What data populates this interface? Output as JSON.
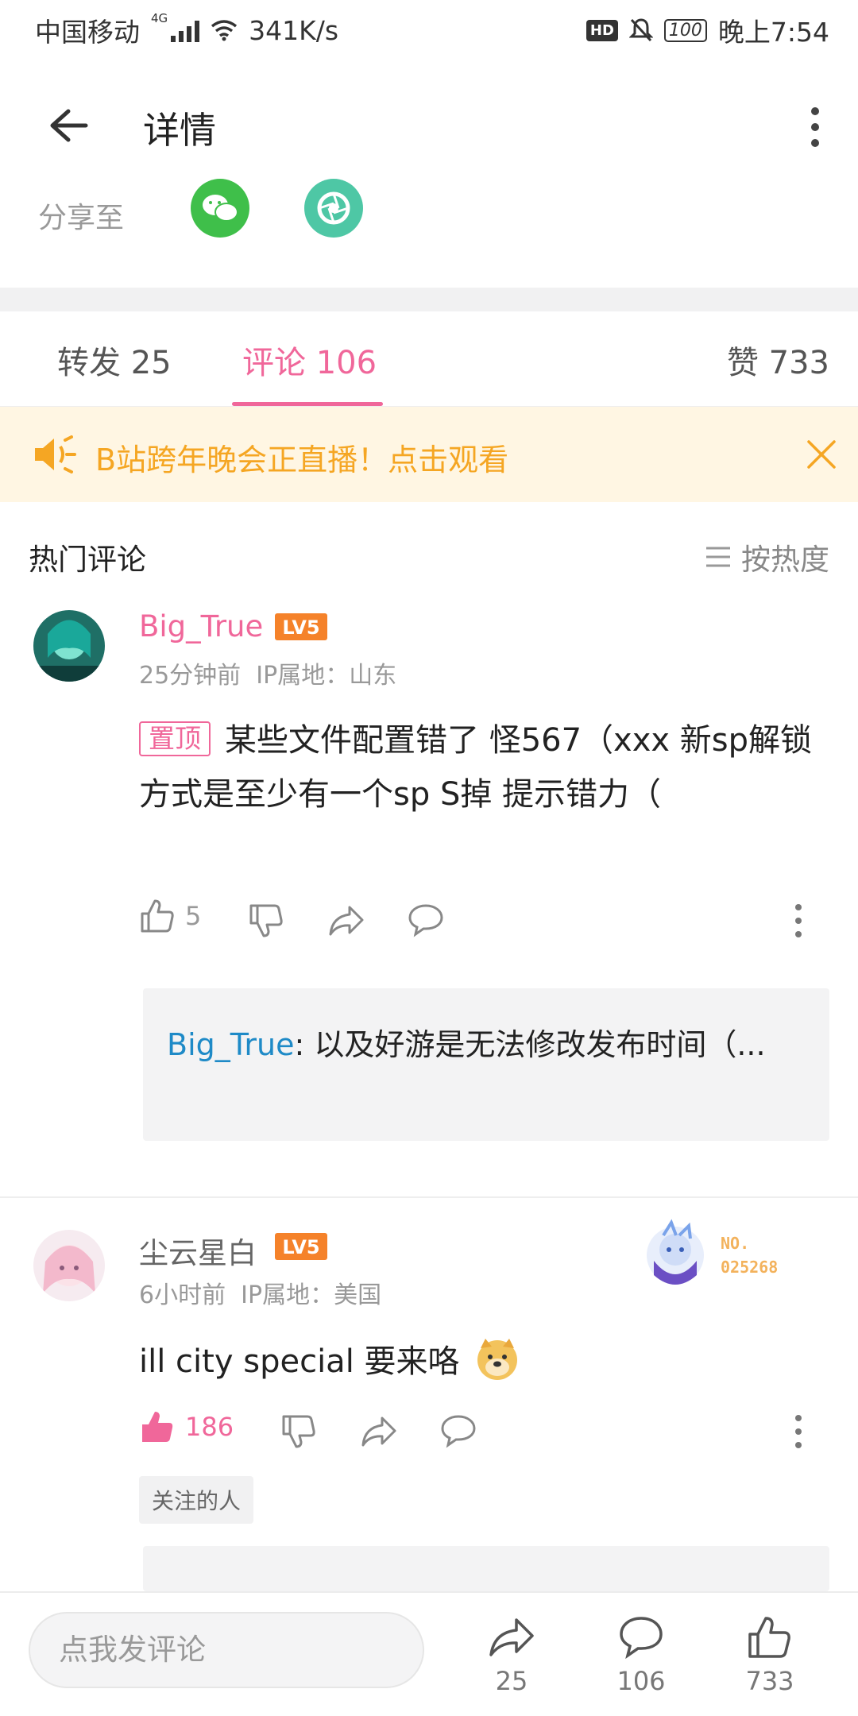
{
  "status_bar": {
    "carrier": "中国移动",
    "network": "4G",
    "speed": "341K/s",
    "hd": "HD",
    "battery": "100",
    "time": "晚上7:54"
  },
  "header": {
    "title": "详情"
  },
  "share": {
    "label": "分享至"
  },
  "tabs": {
    "repost": "转发 25",
    "comment": "评论 106",
    "like": "赞 733"
  },
  "banner": {
    "text": "B站跨年晚会正直播！点击观看"
  },
  "section": {
    "title": "热门评论",
    "sort_label": "按热度"
  },
  "comments": [
    {
      "username": "Big_True",
      "level": "LV5",
      "time": "25分钟前",
      "ip": "IP属地：山东",
      "pinned_label": "置顶",
      "text": "某些文件配置错了 怪567（xxx 新sp解锁方式是至少有一个sp S掉 提示错力（",
      "likes": "5",
      "reply": {
        "user": "Big_True",
        "text": ": 以及好游是无法修改发布时间（..."
      }
    },
    {
      "username": "尘云星白",
      "level": "LV5",
      "time": "6小时前",
      "ip": "IP属地：美国",
      "text": "ill city special 要来咯",
      "likes": "186",
      "tag": "关注的人",
      "fan_no_label": "NO.",
      "fan_no": "025268"
    }
  ],
  "bottom_bar": {
    "input_placeholder": "点我发评论",
    "repost_count": "25",
    "comment_count": "106",
    "like_count": "733"
  },
  "colors": {
    "accent_pink": "#f0679a",
    "banner_bg": "#fff6e3",
    "banner_text": "#f5a623",
    "reply_user": "#1e8ac7",
    "level_badge": "#f5822a"
  }
}
